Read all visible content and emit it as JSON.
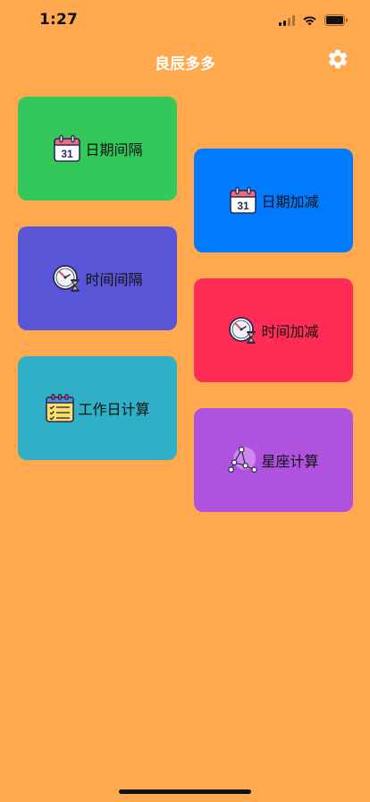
{
  "status_bar": {
    "time": "1:27"
  },
  "nav": {
    "title": "良辰多多"
  },
  "cards": [
    {
      "label": "日期间隔",
      "icon": "calendar-icon",
      "color": "#34C759"
    },
    {
      "label": "日期加减",
      "icon": "calendar-icon",
      "color": "#007AFF"
    },
    {
      "label": "时间间隔",
      "icon": "clock-hourglass-icon",
      "color": "#5856D6"
    },
    {
      "label": "时间加减",
      "icon": "clock-hourglass-icon",
      "color": "#FF2D55"
    },
    {
      "label": "工作日计算",
      "icon": "checklist-calendar-icon",
      "color": "#30B0C7"
    },
    {
      "label": "星座计算",
      "icon": "constellation-icon",
      "color": "#AF52DE"
    }
  ],
  "colors": {
    "background": "#FFA84E",
    "nav_title": "#FFFFFF"
  }
}
